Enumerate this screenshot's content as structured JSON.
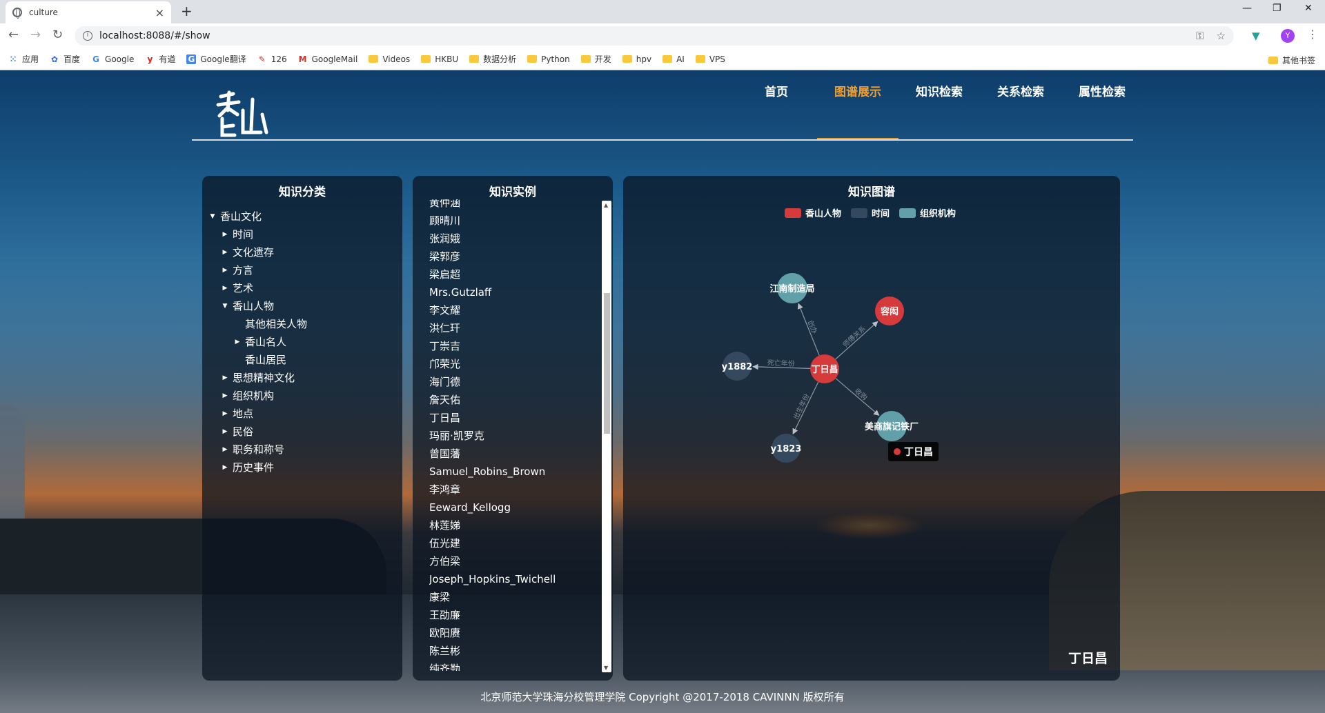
{
  "browser": {
    "tab_title": "culture",
    "tab_close": "×",
    "new_tab": "+",
    "url": "localhost:8088/#/show",
    "bookmarks": [
      {
        "label": "应用",
        "icon": "apps-grid-icon"
      },
      {
        "label": "百度",
        "icon": "baidu-paw-icon"
      },
      {
        "label": "Google",
        "icon": "google-g-icon"
      },
      {
        "label": "有道",
        "icon": "youdao-icon"
      },
      {
        "label": "Google翻译",
        "icon": "google-translate-icon"
      },
      {
        "label": "126",
        "icon": "netease-126-icon"
      },
      {
        "label": "GoogleMail",
        "icon": "gmail-icon"
      },
      {
        "label": "Videos",
        "icon": "folder-icon"
      },
      {
        "label": "HKBU",
        "icon": "folder-icon"
      },
      {
        "label": "数据分析",
        "icon": "folder-icon"
      },
      {
        "label": "Python",
        "icon": "folder-icon"
      },
      {
        "label": "开发",
        "icon": "folder-icon"
      },
      {
        "label": "hpv",
        "icon": "folder-icon"
      },
      {
        "label": "AI",
        "icon": "folder-icon"
      },
      {
        "label": "VPS",
        "icon": "folder-icon"
      }
    ],
    "other_bookmarks": "其他书签",
    "avatar_letter": "Y"
  },
  "header": {
    "nav": [
      {
        "label": "首页",
        "active": false
      },
      {
        "label": "图谱展示",
        "active": true
      },
      {
        "label": "知识检索",
        "active": false
      },
      {
        "label": "关系检索",
        "active": false
      },
      {
        "label": "属性检索",
        "active": false
      }
    ]
  },
  "category_panel": {
    "title": "知识分类",
    "tree": [
      {
        "label": "香山文化",
        "level": 0,
        "arrow": "down"
      },
      {
        "label": "时间",
        "level": 1,
        "arrow": "right"
      },
      {
        "label": "文化遗存",
        "level": 1,
        "arrow": "right"
      },
      {
        "label": "方言",
        "level": 1,
        "arrow": "right"
      },
      {
        "label": "艺术",
        "level": 1,
        "arrow": "right"
      },
      {
        "label": "香山人物",
        "level": 1,
        "arrow": "down"
      },
      {
        "label": "其他相关人物",
        "level": 2,
        "arrow": "none"
      },
      {
        "label": "香山名人",
        "level": 2,
        "arrow": "right"
      },
      {
        "label": "香山居民",
        "level": 2,
        "arrow": "none"
      },
      {
        "label": "思想精神文化",
        "level": 1,
        "arrow": "right"
      },
      {
        "label": "组织机构",
        "level": 1,
        "arrow": "right"
      },
      {
        "label": "地点",
        "level": 1,
        "arrow": "right"
      },
      {
        "label": "民俗",
        "level": 1,
        "arrow": "right"
      },
      {
        "label": "职务和称号",
        "level": 1,
        "arrow": "right"
      },
      {
        "label": "历史事件",
        "level": 1,
        "arrow": "right"
      }
    ]
  },
  "instance_panel": {
    "title": "知识实例",
    "items": [
      "黄仲涵",
      "顾晴川",
      "张润娥",
      "梁郭彦",
      "梁启超",
      "Mrs.Gutzlaff",
      "李文耀",
      "洪仁玕",
      "丁崇吉",
      "邝荣光",
      "海门德",
      "詹天佑",
      "丁日昌",
      "玛丽·凯罗克",
      "曾国藩",
      "Samuel_Robins_Brown",
      "李鸿章",
      "Eeward_Kellogg",
      "林莲娣",
      "伍光建",
      "方伯梁",
      "Joseph_Hopkins_Twichell",
      "康梁",
      "王劭廉",
      "欧阳赓",
      "陈兰彬",
      "纯齐勒"
    ]
  },
  "graph_panel": {
    "title": "知识图谱",
    "legend": [
      {
        "label": "香山人物",
        "color": "#d63a3a"
      },
      {
        "label": "时间",
        "color": "#34495e"
      },
      {
        "label": "组织机构",
        "color": "#61a0a8"
      }
    ],
    "nodes": [
      {
        "id": "center",
        "label": "丁日昌",
        "category": 0
      },
      {
        "id": "n1",
        "label": "江南制造局",
        "category": 2
      },
      {
        "id": "n2",
        "label": "容闳",
        "category": 0
      },
      {
        "id": "n3",
        "label": "y1882",
        "category": 1
      },
      {
        "id": "n4",
        "label": "y1823",
        "category": 1
      },
      {
        "id": "n5",
        "label": "美商旗记铁厂",
        "category": 2
      }
    ],
    "edges": [
      {
        "target": "n1",
        "label": "创办"
      },
      {
        "target": "n2",
        "label": "师傅关系"
      },
      {
        "target": "n3",
        "label": "死亡年份"
      },
      {
        "target": "n4",
        "label": "出生年份"
      },
      {
        "target": "n5",
        "label": "收购"
      }
    ],
    "tooltip": "丁日昌",
    "selected_title": "丁日昌"
  },
  "footer": {
    "copyright": "北京师范大学珠海分校管理学院 Copyright @2017-2018 CAVINNN 版权所有"
  }
}
